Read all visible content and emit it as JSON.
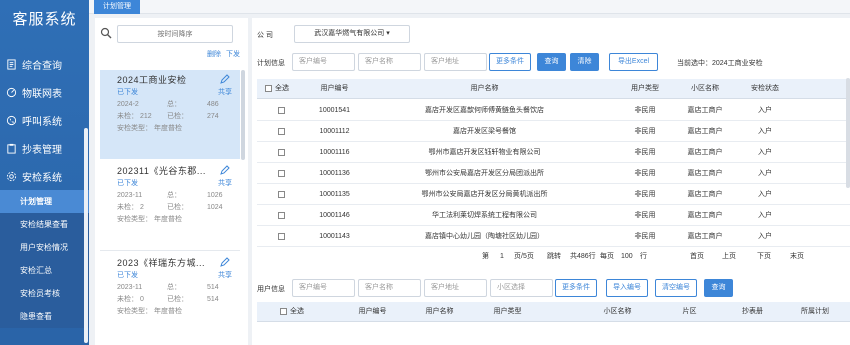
{
  "sidebar": {
    "brand": "客服系统",
    "items": [
      {
        "label": "综合查询",
        "icon": "doc-icon"
      },
      {
        "label": "物联网表",
        "icon": "meter-icon"
      },
      {
        "label": "呼叫系统",
        "icon": "phone-icon"
      },
      {
        "label": "抄表管理",
        "icon": "clipboard-icon"
      },
      {
        "label": "安检系统",
        "icon": "gear-icon"
      }
    ],
    "sub_items": [
      "计划管理",
      "安检结果查看",
      "用户安检情况",
      "安检汇总",
      "安检员考核",
      "隐患查看"
    ]
  },
  "tabs": {
    "active": "计划管理"
  },
  "plan_list": {
    "search_placeholder": "按时间降序",
    "delete_label": "删除",
    "issue_label": "下发",
    "cards": [
      {
        "title": "2024工商业安检",
        "status": "已下发",
        "share": "共享",
        "date": "2024-2",
        "total_label": "总：",
        "total": "486",
        "unchecked_label": "未检：",
        "unchecked": "212",
        "checked_label": "已检：",
        "checked": "274",
        "type": "安检类型：  年度普检"
      },
      {
        "title": "202311《光谷东郡...",
        "status": "已下发",
        "share": "共享",
        "date": "2023-11",
        "total_label": "总：",
        "total": "1026",
        "unchecked_label": "未检：",
        "unchecked": "2",
        "checked_label": "已检：",
        "checked": "1024",
        "type": "安检类型：  年度普检"
      },
      {
        "title": "2023《祥瑞东方城...",
        "status": "已下发",
        "share": "共享",
        "date": "2023-11",
        "total_label": "总：",
        "total": "514",
        "unchecked_label": "未检：",
        "unchecked": "0",
        "checked_label": "已检：",
        "checked": "514",
        "type": "安检类型：  年度普检"
      }
    ]
  },
  "main": {
    "company_label": "公    司",
    "company_value": "武汉嘉华燃气有限公司 ▾",
    "plan_info_label": "计划信息",
    "ph_user_no": "客户编号",
    "ph_user_name": "客户名称",
    "ph_user_addr": "客户地址",
    "btn_more": "更多条件",
    "btn_query": "查询",
    "btn_clear": "清除",
    "btn_export": "导出Excel",
    "current_selected": "当前选中：2024工商业安检",
    "headers": [
      "全选",
      "用户编号",
      "用户名称",
      "用户类型",
      "小区名称",
      "安检状态"
    ],
    "rows": [
      {
        "no": "10001541",
        "name": "嘉店开发区嘉歆何师傅黄鲢鱼头餐饮店",
        "type": "非民用",
        "area": "嘉店工商户",
        "status": "入户"
      },
      {
        "no": "10001112",
        "name": "嘉店开发区梁号餐馆",
        "type": "非民用",
        "area": "嘉店工商户",
        "status": "入户"
      },
      {
        "no": "10001116",
        "name": "鄂州市嘉店开发区钰轩物业有限公司",
        "type": "非民用",
        "area": "嘉店工商户",
        "status": "入户"
      },
      {
        "no": "10001136",
        "name": "鄂州市公安局嘉店开发区分局团派出所",
        "type": "非民用",
        "area": "嘉店工商户",
        "status": "入户"
      },
      {
        "no": "10001135",
        "name": "鄂州市公安局嘉店开发区分局黄机派出所",
        "type": "非民用",
        "area": "嘉店工商户",
        "status": "入户"
      },
      {
        "no": "10001146",
        "name": "华工法利莱切焊系统工程有限公司",
        "type": "非民用",
        "area": "嘉店工商户",
        "status": "入户"
      },
      {
        "no": "10001143",
        "name": "嘉店镇中心幼儿园（陶塘社区幼儿园）",
        "type": "非民用",
        "area": "嘉店工商户",
        "status": "入户"
      }
    ],
    "pager": {
      "label1": "第",
      "page": "1",
      "label2": "页/5页",
      "jump": "跳转",
      "total": "共486行",
      "per_page_label": "每页",
      "per_page": "100",
      "unit": "行",
      "first": "首页",
      "prev": "上页",
      "next": "下页",
      "last": "末页"
    },
    "user_info_label": "用户信息",
    "ph_area": "小区选择",
    "btn_import": "导入编号",
    "btn_clear_no": "清空编号",
    "headers2": [
      "全选",
      "用户编号",
      "用户名称",
      "用户类型",
      "小区名称",
      "片区",
      "抄表册",
      "所属计划"
    ]
  }
}
